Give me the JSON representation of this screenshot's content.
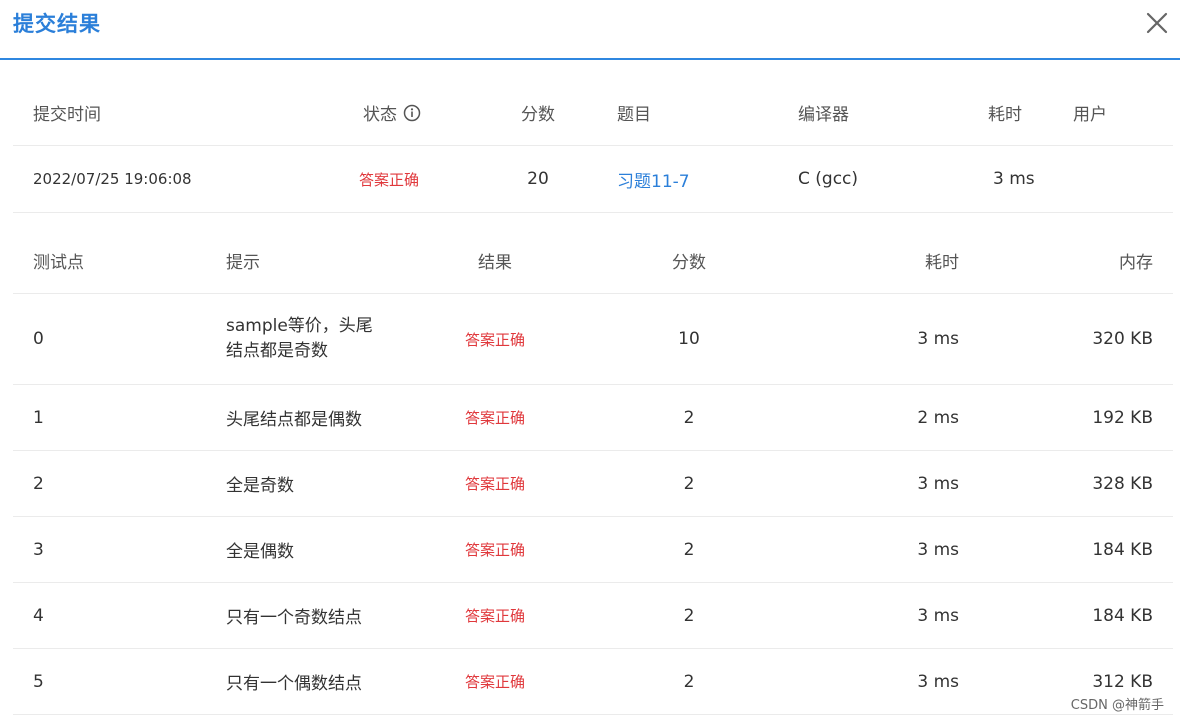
{
  "dialog": {
    "title": "提交结果"
  },
  "summary": {
    "headers": {
      "time": "提交时间",
      "status": "状态",
      "score": "分数",
      "problem": "题目",
      "compiler": "编译器",
      "duration": "耗时",
      "user": "用户"
    },
    "row": {
      "time": "2022/07/25 19:06:08",
      "status": "答案正确",
      "score": "20",
      "problem": "习题11-7",
      "compiler": "C (gcc)",
      "duration": "3 ms",
      "user": ""
    }
  },
  "tests": {
    "headers": {
      "id": "测试点",
      "hint": "提示",
      "result": "结果",
      "score": "分数",
      "duration": "耗时",
      "memory": "内存"
    },
    "rows": [
      {
        "id": "0",
        "hint": "sample等价，头尾结点都是奇数",
        "result": "答案正确",
        "score": "10",
        "duration": "3 ms",
        "memory": "320 KB"
      },
      {
        "id": "1",
        "hint": "头尾结点都是偶数",
        "result": "答案正确",
        "score": "2",
        "duration": "2 ms",
        "memory": "192 KB"
      },
      {
        "id": "2",
        "hint": "全是奇数",
        "result": "答案正确",
        "score": "2",
        "duration": "3 ms",
        "memory": "328 KB"
      },
      {
        "id": "3",
        "hint": "全是偶数",
        "result": "答案正确",
        "score": "2",
        "duration": "3 ms",
        "memory": "184 KB"
      },
      {
        "id": "4",
        "hint": "只有一个奇数结点",
        "result": "答案正确",
        "score": "2",
        "duration": "3 ms",
        "memory": "184 KB"
      },
      {
        "id": "5",
        "hint": "只有一个偶数结点",
        "result": "答案正确",
        "score": "2",
        "duration": "3 ms",
        "memory": "312 KB"
      }
    ]
  },
  "watermark": "CSDN @神箭手",
  "colors": {
    "accent": "#2b7fd9",
    "success_text": "#e0383c"
  }
}
